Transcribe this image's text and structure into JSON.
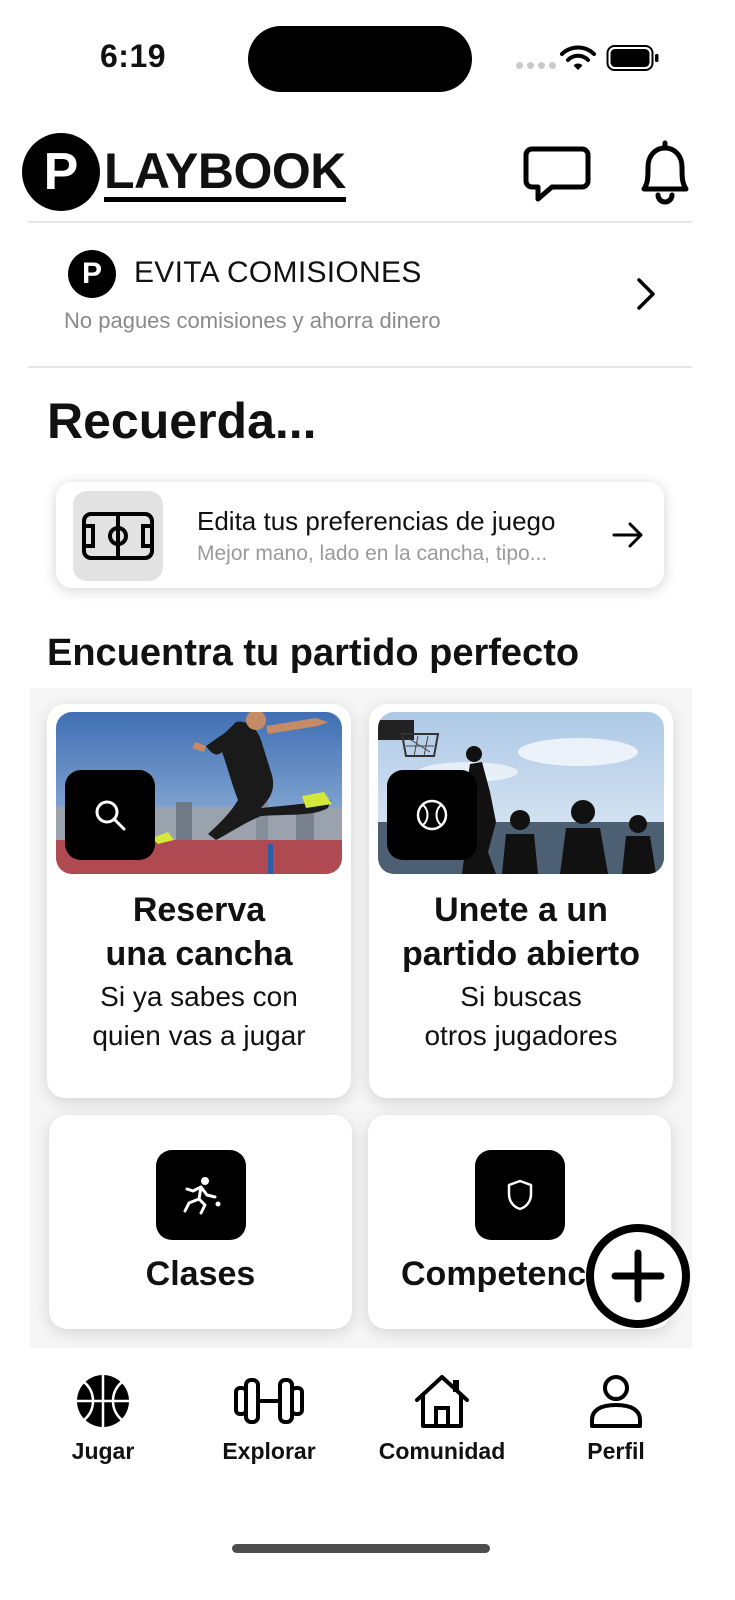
{
  "status_bar": {
    "time": "6:19"
  },
  "header": {
    "logo_letter": "P",
    "logo_text": "LAYBOOK",
    "chat_icon": "chat-bubble-icon",
    "bell_icon": "bell-icon"
  },
  "promo": {
    "logo_letter": "P",
    "title": "EVITA COMISIONES",
    "subtitle": "No pagues comisiones y ahorra dinero"
  },
  "reminder": {
    "heading": "Recuerda...",
    "card_title": "Edita tus preferencias de juego",
    "card_subtitle": "Mejor mano, lado en la cancha, tipo..."
  },
  "match_section": {
    "heading": "Encuentra tu partido perfecto",
    "cards": [
      {
        "title_line1": "Reserva",
        "title_line2": "una cancha",
        "sub_line1": "Si ya sabes con",
        "sub_line2": "quien vas a jugar",
        "icon": "search-icon"
      },
      {
        "title_line1": "Unete a un",
        "title_line2": "partido abierto",
        "sub_line1": "Si buscas",
        "sub_line2": "otros jugadores",
        "icon": "ball-icon"
      }
    ],
    "small_cards": [
      {
        "title": "Clases",
        "icon": "kick-icon"
      },
      {
        "title": "Competenc",
        "icon": "shield-icon"
      }
    ]
  },
  "fab": {
    "icon": "plus-icon"
  },
  "bottom_nav": [
    {
      "label": "Jugar",
      "icon": "basketball-icon"
    },
    {
      "label": "Explorar",
      "icon": "dumbbell-icon"
    },
    {
      "label": "Comunidad",
      "icon": "home-icon"
    },
    {
      "label": "Perfil",
      "icon": "person-icon"
    }
  ],
  "colors": {
    "accent": "#000000",
    "muted_text": "#8a8a8a",
    "card_bg": "#ffffff"
  }
}
